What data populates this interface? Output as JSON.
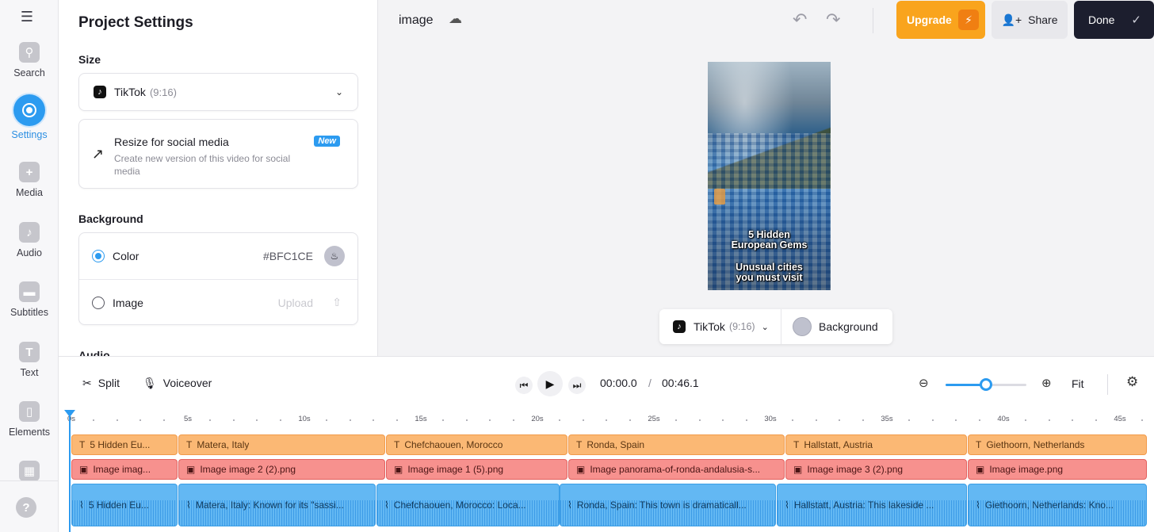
{
  "rail": {
    "items": [
      {
        "label": "Search",
        "icon": "search-icon"
      },
      {
        "label": "Settings",
        "icon": "settings-icon"
      },
      {
        "label": "Media",
        "icon": "plus-icon"
      },
      {
        "label": "Audio",
        "icon": "music-note-icon"
      },
      {
        "label": "Subtitles",
        "icon": "subtitles-icon"
      },
      {
        "label": "Text",
        "icon": "text-icon"
      },
      {
        "label": "Elements",
        "icon": "elements-icon"
      }
    ]
  },
  "panel": {
    "title": "Project Settings",
    "size_title": "Size",
    "size_value": "TikTok",
    "size_ratio": "(9:16)",
    "resize_title": "Resize for social media",
    "resize_desc": "Create new version of this video for social media",
    "resize_badge": "New",
    "background_title": "Background",
    "bg_color_label": "Color",
    "bg_color_hex": "#BFC1CE",
    "bg_image_label": "Image",
    "bg_upload_label": "Upload",
    "audio_title": "Audio"
  },
  "topbar": {
    "project_name": "image",
    "upgrade_label": "Upgrade",
    "share_label": "Share",
    "done_label": "Done"
  },
  "canvas": {
    "caption_line1": "5 Hidden",
    "caption_line2": "European Gems",
    "caption_line3": "Unusual cities",
    "caption_line4": "you must visit",
    "size_value": "TikTok",
    "size_ratio": "(9:16)",
    "background_label": "Background",
    "background_color": "#BFC1CE"
  },
  "timeline": {
    "split_label": "Split",
    "voiceover_label": "Voiceover",
    "current_time": "00:00.0",
    "separator": "/",
    "duration": "00:46.1",
    "fit_label": "Fit",
    "zoom_level": 0.5,
    "ruler_labels": [
      "0s",
      "5s",
      "10s",
      "15s",
      "20s",
      "25s",
      "30s",
      "35s",
      "40s",
      "45s"
    ],
    "text_clips": [
      "5 Hidden Eu...",
      "Matera, Italy",
      "Chefchaouen, Morocco",
      "Ronda, Spain",
      "Hallstatt, Austria",
      "Giethoorn, Netherlands"
    ],
    "image_clips": [
      "Image imag...",
      "Image image 2 (2).png",
      "Image image 1 (5).png",
      "Image panorama-of-ronda-andalusia-s...",
      "Image image 3 (2).png",
      "Image image.png"
    ],
    "audio_clips": [
      "5 Hidden Eu...",
      "Matera, Italy:  Known for its \"sassi...",
      "Chefchaouen, Morocco: Loca...",
      "Ronda, Spain: This town is dramaticall...",
      "Hallstatt, Austria: This lakeside ...",
      "Giethoorn, Netherlands:  Kno..."
    ]
  },
  "colors": {
    "accent": "#2C9BF0",
    "upgrade": "#F9A41D",
    "done": "#1C1E2E",
    "text_clip": "#FBB874",
    "image_clip": "#F7918E",
    "audio_clip": "#63B8F3"
  }
}
